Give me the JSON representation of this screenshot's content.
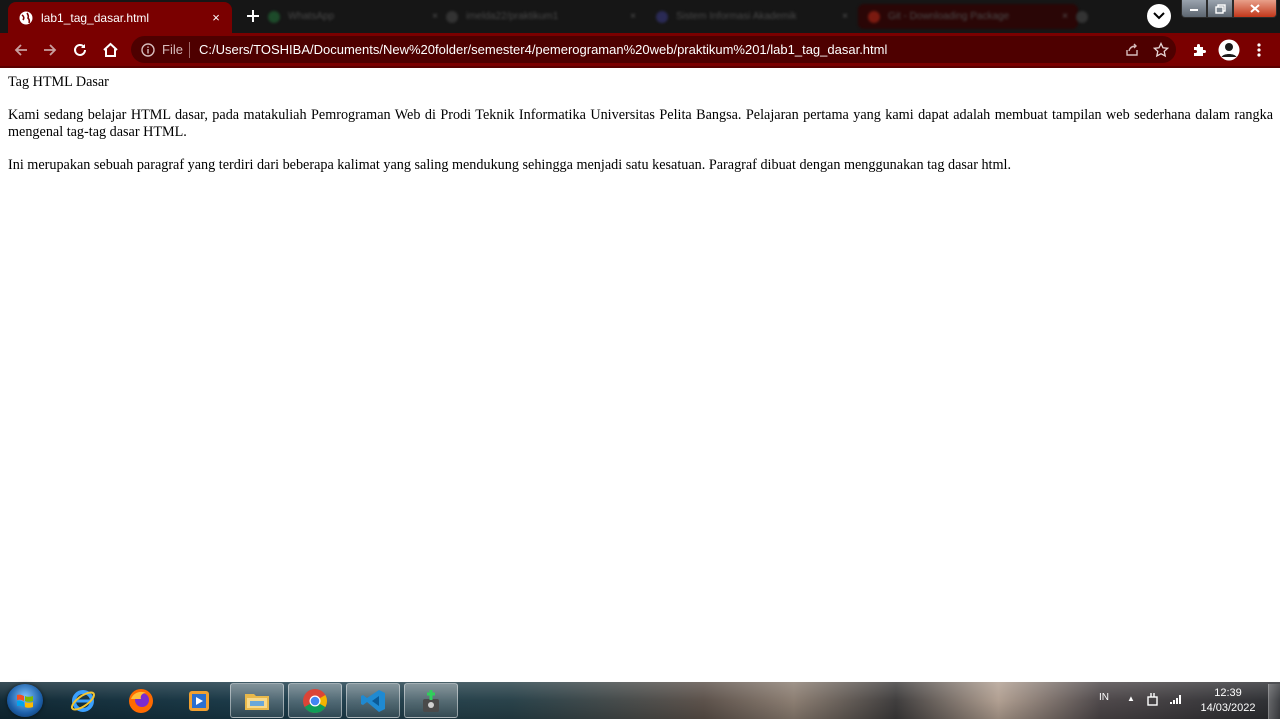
{
  "browser": {
    "tab": {
      "title": "lab1_tag_dasar.html",
      "close_glyph": "×"
    },
    "newtab_glyph": "+",
    "background_tabs": [
      "WhatsApp",
      "imelda22/praktikum1",
      "Sistem Informasi Akademik",
      "Git - Downloading Package"
    ],
    "omnibox": {
      "scheme_label": "File",
      "url": "C:/Users/TOSHIBA/Documents/New%20folder/semester4/pemerograman%20web/praktikum%201/lab1_tag_dasar.html"
    },
    "theme_color": "#7a0000"
  },
  "page": {
    "heading": "Tag HTML Dasar",
    "paragraph1": "Kami sedang belajar HTML dasar, pada matakuliah Pemrograman Web di Prodi Teknik Informatika Universitas Pelita Bangsa. Pelajaran pertama yang kami dapat adalah membuat tampilan web sederhana dalam rangka mengenal tag-tag dasar HTML.",
    "paragraph2": "Ini merupakan sebuah paragraf yang terdiri dari beberapa kalimat yang saling mendukung sehingga menjadi satu kesatuan. Paragraf dibuat dengan menggunakan tag dasar html."
  },
  "taskbar": {
    "apps": [
      "internet-explorer",
      "firefox",
      "media-player",
      "file-explorer",
      "chrome",
      "vscode",
      "git"
    ],
    "tray": {
      "language": "IN",
      "time": "12:39",
      "date": "14/03/2022"
    }
  }
}
